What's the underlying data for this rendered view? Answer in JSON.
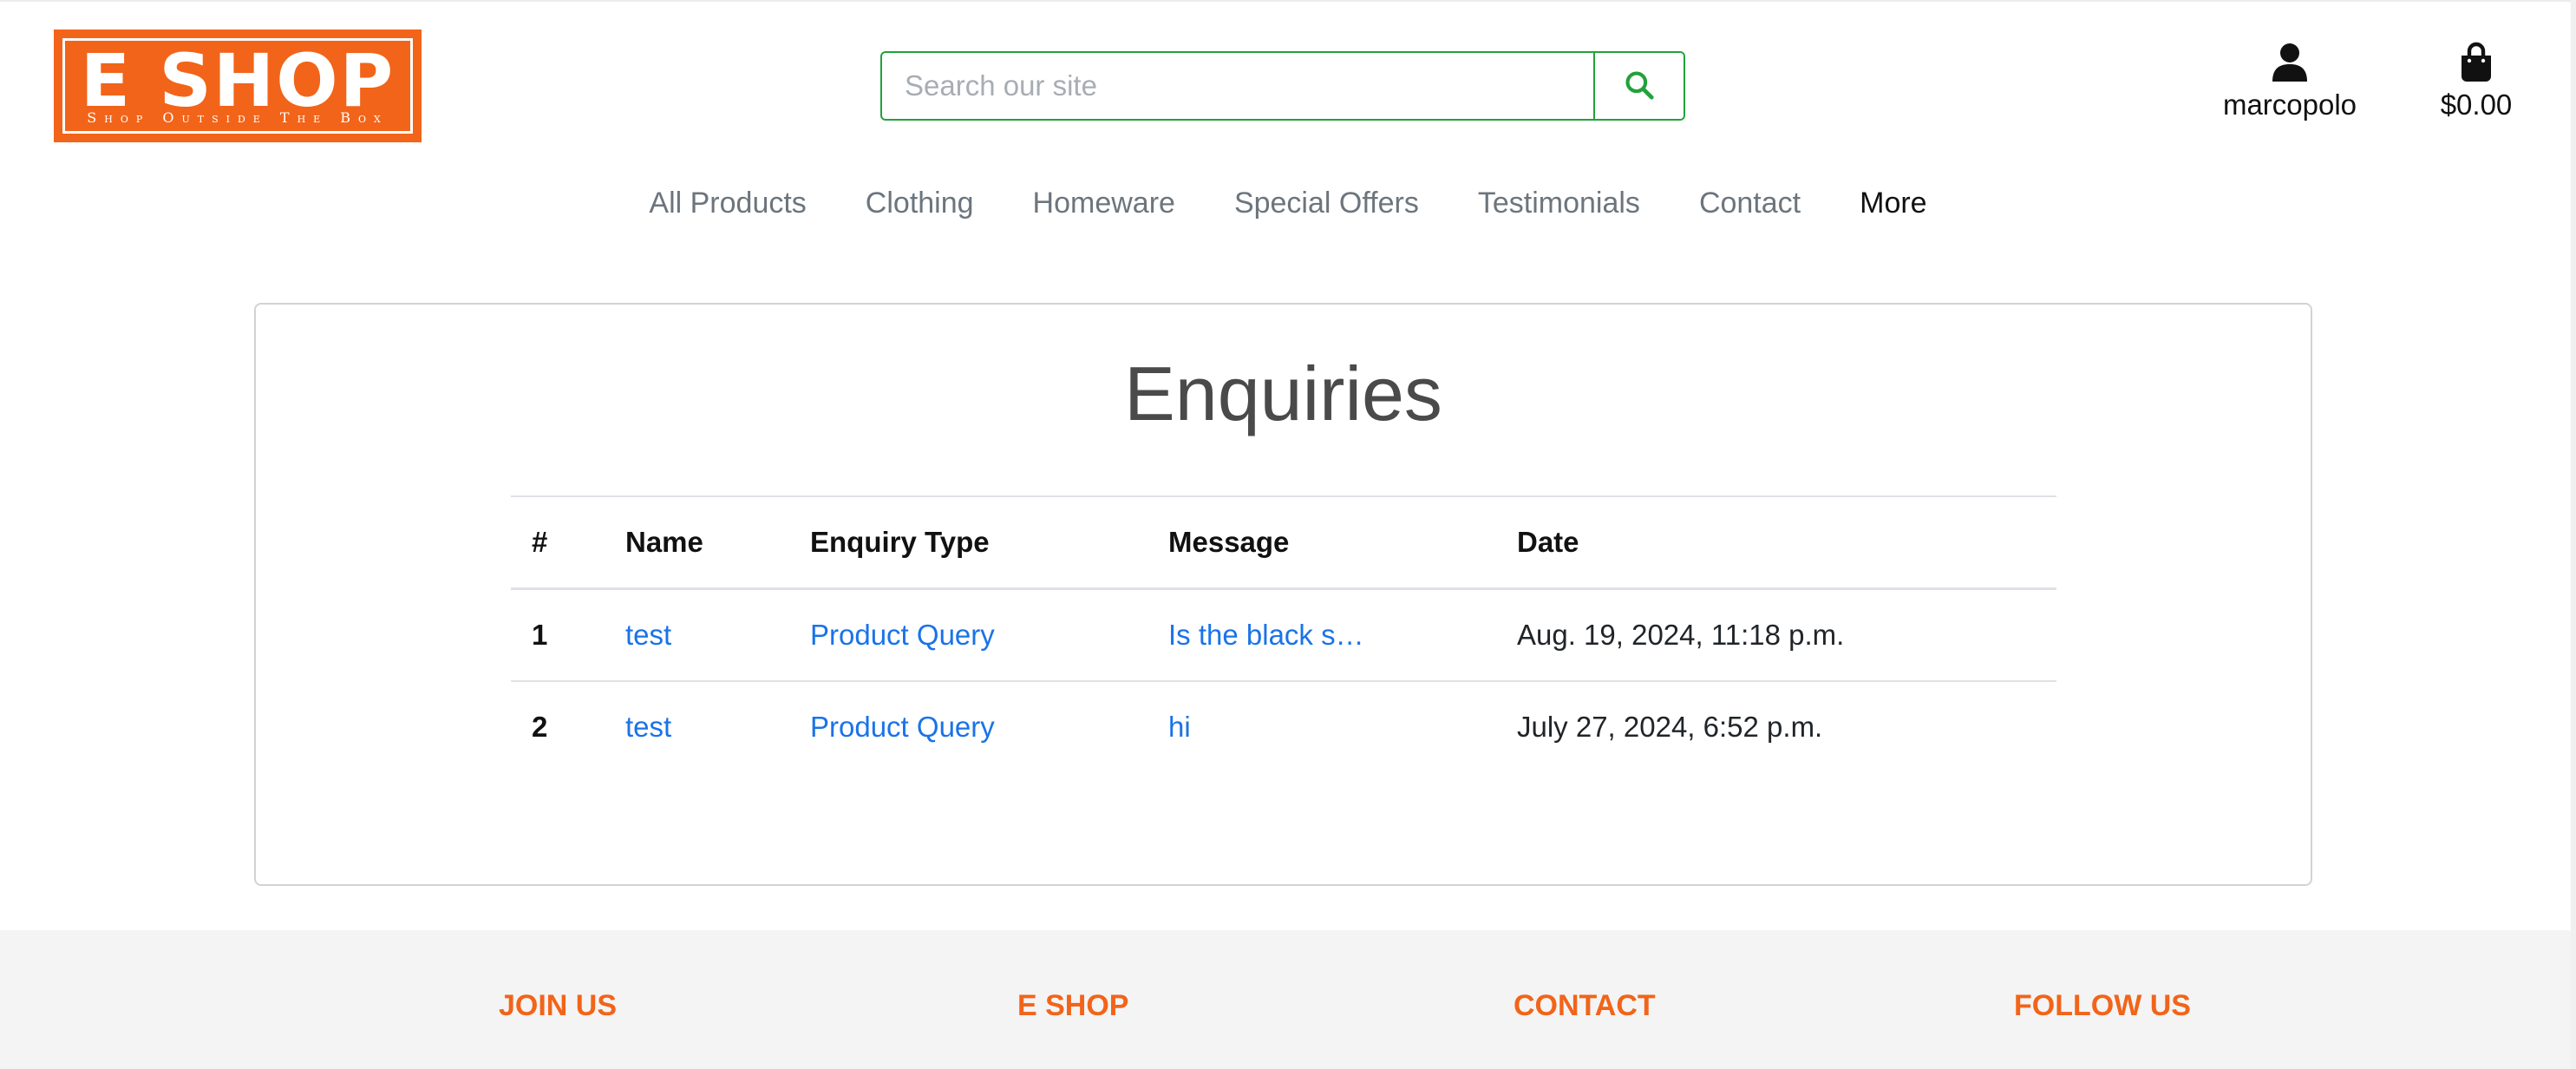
{
  "brand": {
    "logo_title": "E SHOP",
    "logo_tagline": "Shop Outside The Box",
    "accent_color": "#f26419"
  },
  "search": {
    "placeholder": "Search our site",
    "icon": "search-icon",
    "border_color": "#22a13a"
  },
  "account": {
    "icon": "user-icon",
    "label": "marcopolo"
  },
  "cart": {
    "icon": "shopping-bag-icon",
    "total": "$0.00"
  },
  "nav": {
    "items": [
      "All Products",
      "Clothing",
      "Homeware",
      "Special Offers",
      "Testimonials",
      "Contact",
      "More"
    ]
  },
  "main": {
    "title": "Enquiries",
    "table": {
      "headers": [
        "#",
        "Name",
        "Enquiry Type",
        "Message",
        "Date"
      ],
      "rows": [
        {
          "num": "1",
          "name": "test",
          "type": "Product Query",
          "message": "Is the black s…",
          "date": "Aug. 19, 2024, 11:18 p.m."
        },
        {
          "num": "2",
          "name": "test",
          "type": "Product Query",
          "message": "hi",
          "date": "July 27, 2024, 6:52 p.m."
        }
      ]
    }
  },
  "footer": {
    "headings": [
      "JOIN US",
      "E SHOP",
      "CONTACT",
      "FOLLOW US"
    ]
  }
}
